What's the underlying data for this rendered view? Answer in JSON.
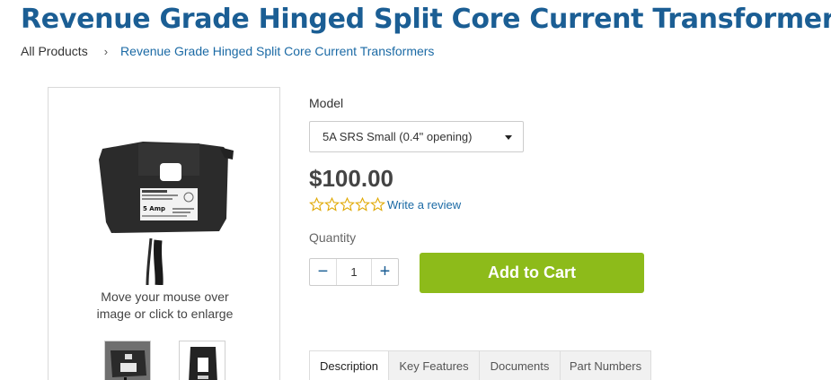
{
  "page": {
    "title": "Revenue Grade Hinged Split Core Current Transformers"
  },
  "breadcrumb": {
    "home": "All Products",
    "separator": "›",
    "current": "Revenue Grade Hinged Split Core Current Transformers"
  },
  "gallery": {
    "zoom_hint_line1": "Move your mouse over",
    "zoom_hint_line2": "image or click to enlarge",
    "main_image_label_line1": "5 Amp",
    "thumbnails": [
      "thumbnail-front",
      "thumbnail-opening"
    ]
  },
  "product": {
    "model_label": "Model",
    "model_selected": "5A SRS Small (0.4\" opening)",
    "price": "$100.00",
    "rating_stars": 0,
    "rating_max": 5,
    "review_link": "Write a review",
    "quantity_label": "Quantity",
    "quantity_value": "1",
    "decrement_symbol": "−",
    "increment_symbol": "+",
    "add_to_cart": "Add to Cart"
  },
  "tabs": [
    {
      "label": "Description",
      "active": true
    },
    {
      "label": "Key Features",
      "active": false
    },
    {
      "label": "Documents",
      "active": false
    },
    {
      "label": "Part Numbers",
      "active": false
    }
  ],
  "colors": {
    "title": "#1b5e94",
    "link": "#1b6aa5",
    "star_outline": "#e0a800",
    "cart_button": "#8dbb1a"
  }
}
